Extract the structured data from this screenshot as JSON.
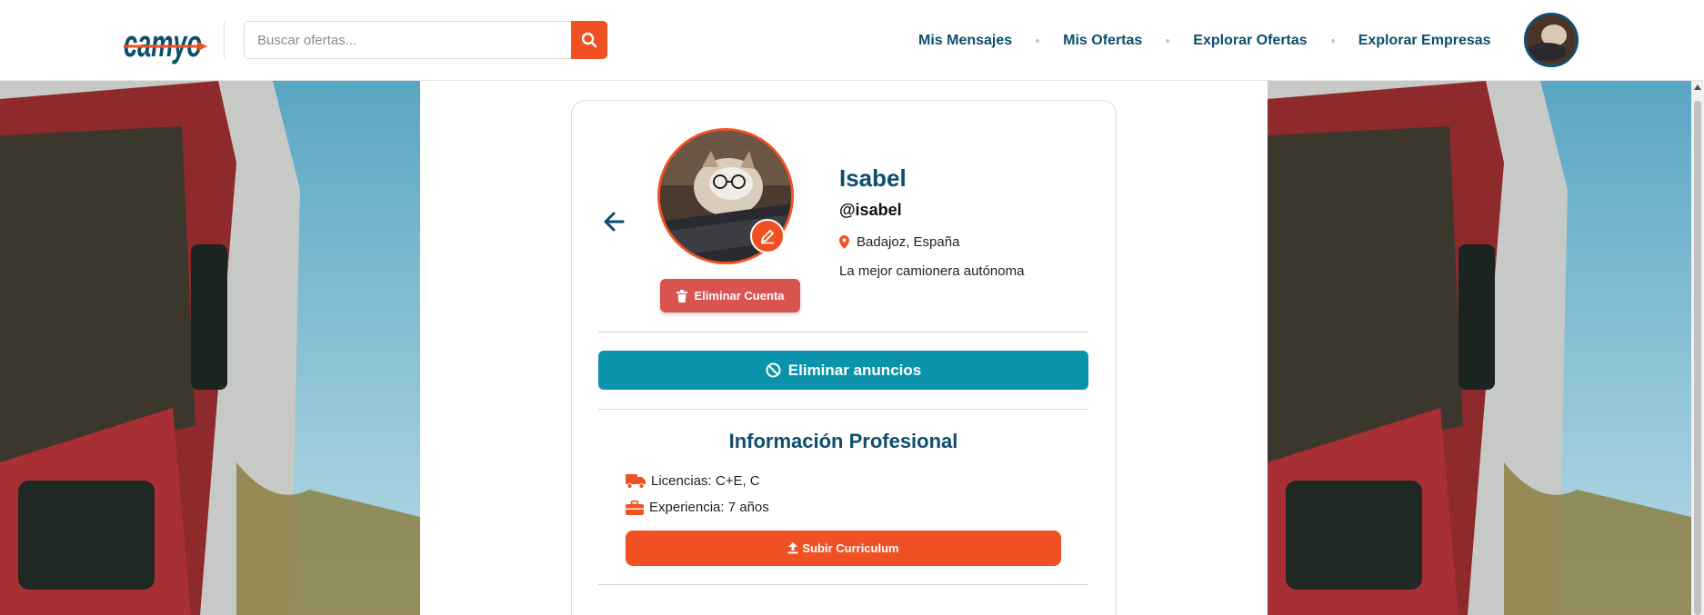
{
  "header": {
    "logo_text": "camyo",
    "search_placeholder": "Buscar ofertas...",
    "nav": [
      {
        "label": "Mis Mensajes"
      },
      {
        "label": "Mis Ofertas"
      },
      {
        "label": "Explorar Ofertas"
      },
      {
        "label": "Explorar Empresas"
      }
    ]
  },
  "profile": {
    "name": "Isabel",
    "handle": "@isabel",
    "location": "Badajoz, España",
    "bio": "La mejor camionera autónoma",
    "delete_account_label": "Eliminar Cuenta",
    "remove_ads_label": "Eliminar anuncios"
  },
  "professional": {
    "title": "Información Profesional",
    "licenses": "Licencias: C+E, C",
    "experience": "Experiencia: 7 años",
    "upload_cv_label": "Subir Curriculum"
  },
  "colors": {
    "brand_blue": "#0d4e6b",
    "accent_orange": "#f05123",
    "danger_red": "#d9534f",
    "teal": "#0b93ab"
  }
}
